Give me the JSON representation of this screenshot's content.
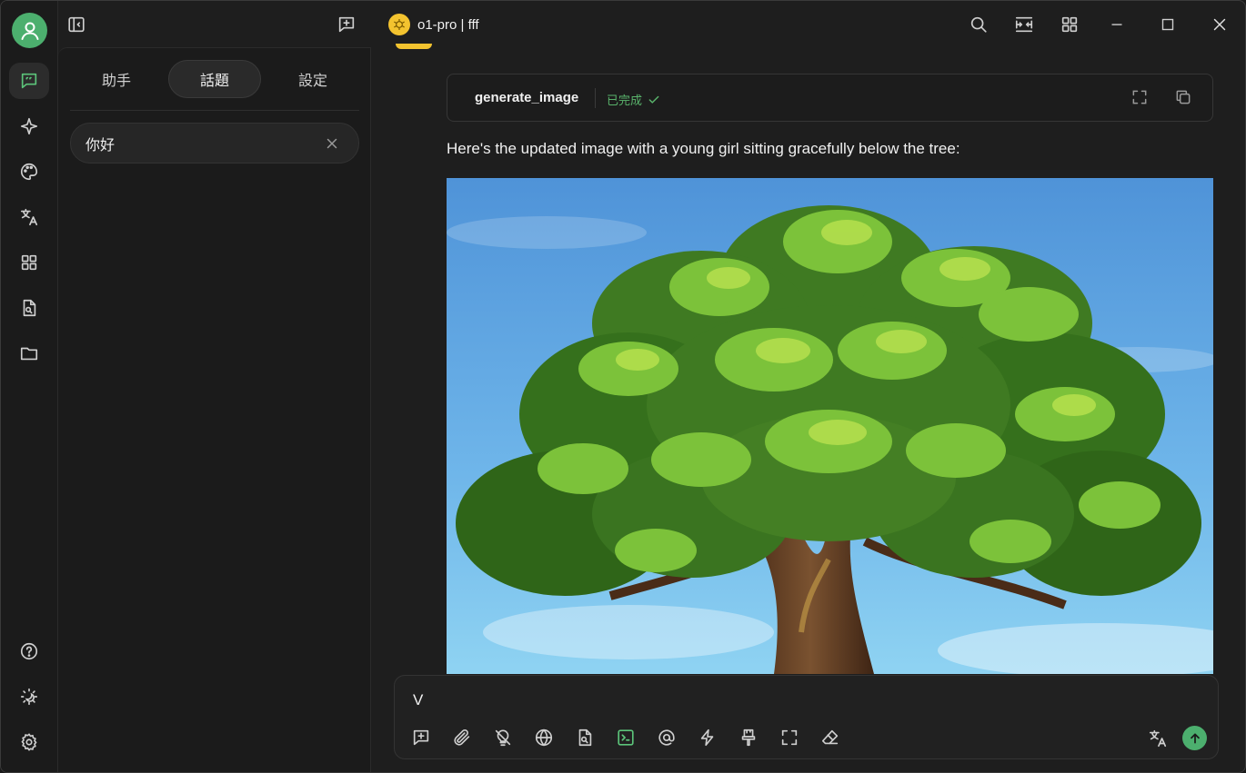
{
  "topbar": {
    "title": "o1-pro | fff"
  },
  "panel": {
    "tabs": [
      {
        "label": "助手"
      },
      {
        "label": "話題"
      },
      {
        "label": "設定"
      }
    ],
    "topics": [
      {
        "label": "你好"
      }
    ]
  },
  "chat": {
    "tool": {
      "name": "generate_image",
      "status": "已完成"
    },
    "reply": "Here's the updated image with a young girl sitting gracefully below the tree:"
  },
  "composer": {
    "text": "V"
  },
  "colors": {
    "accent": "#4caf6e",
    "model_logo": "#f3c32f",
    "status_done": "#59b36b"
  }
}
